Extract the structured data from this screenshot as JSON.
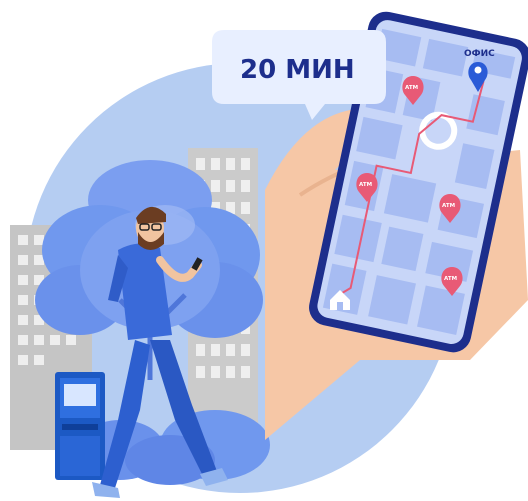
{
  "time_bubble": {
    "text": "20 МИН"
  },
  "map": {
    "destination_label": "ОФИС",
    "atm_pins": [
      {
        "label": "ATM"
      },
      {
        "label": "ATM"
      },
      {
        "label": "ATM"
      },
      {
        "label": "ATM"
      }
    ],
    "home_icon": "home-icon",
    "destination_icon": "location-pin-icon"
  },
  "colors": {
    "circle": "#b5cdf2",
    "buildings": "#c9c9c9",
    "tree": "#6f94ee",
    "phone_frame": "#1d2e8c",
    "map_bg": "#c8d6f8",
    "map_block": "#9fb6f0",
    "pin": "#e85a76",
    "route": "#e85a76",
    "hand": "#f6c7a6",
    "man_shirt": "#3a6ad9",
    "atm": "#1c59c4"
  }
}
